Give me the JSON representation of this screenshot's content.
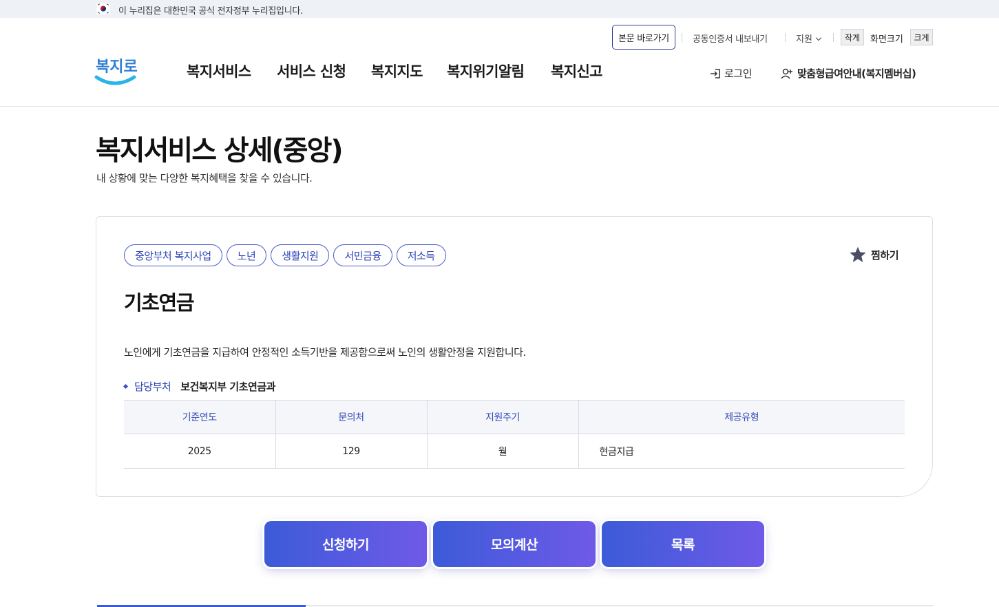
{
  "gov_banner": {
    "text": "이 누리집은 대한민국 공식 전자정부 누리집입니다."
  },
  "util": {
    "skip": "본문 바로가기",
    "cert_export": "공동인증서 내보내기",
    "lang": "지원",
    "size_small": "작게",
    "size_label": "화면크기",
    "size_large": "크게"
  },
  "logo": {
    "text": "복지로"
  },
  "nav": [
    "복지서비스",
    "서비스 신청",
    "복지지도",
    "복지위기알림",
    "복지신고"
  ],
  "account": {
    "login": "로그인",
    "member": "맞춤형급여안내(복지멤버십)"
  },
  "page": {
    "title": "복지서비스 상세(중앙)",
    "subtitle": "내 상황에 맞는 다양한 복지혜택을 찾을 수 있습니다."
  },
  "service": {
    "tags": [
      "중앙부처 복지사업",
      "노년",
      "생활지원",
      "서민금융",
      "저소득"
    ],
    "favorite": "찜하기",
    "title": "기초연금",
    "description": "노인에게 기초연금을 지급하여 안정적인 소득기반을 제공함으로써 노인의 생활안정을 지원합니다.",
    "dept_label": "담당부처",
    "dept_value": "보건복지부 기초연금과",
    "table": {
      "headers": [
        "기준연도",
        "문의처",
        "지원주기",
        "제공유형"
      ],
      "row": [
        "2025",
        "129",
        "월",
        "현금지급"
      ]
    }
  },
  "actions": {
    "apply": "신청하기",
    "simulate": "모의계산",
    "list": "목록"
  },
  "colors": {
    "brand": "#3b5bd6",
    "accent": "#6f5ae8",
    "tag": "#2e44b6"
  }
}
